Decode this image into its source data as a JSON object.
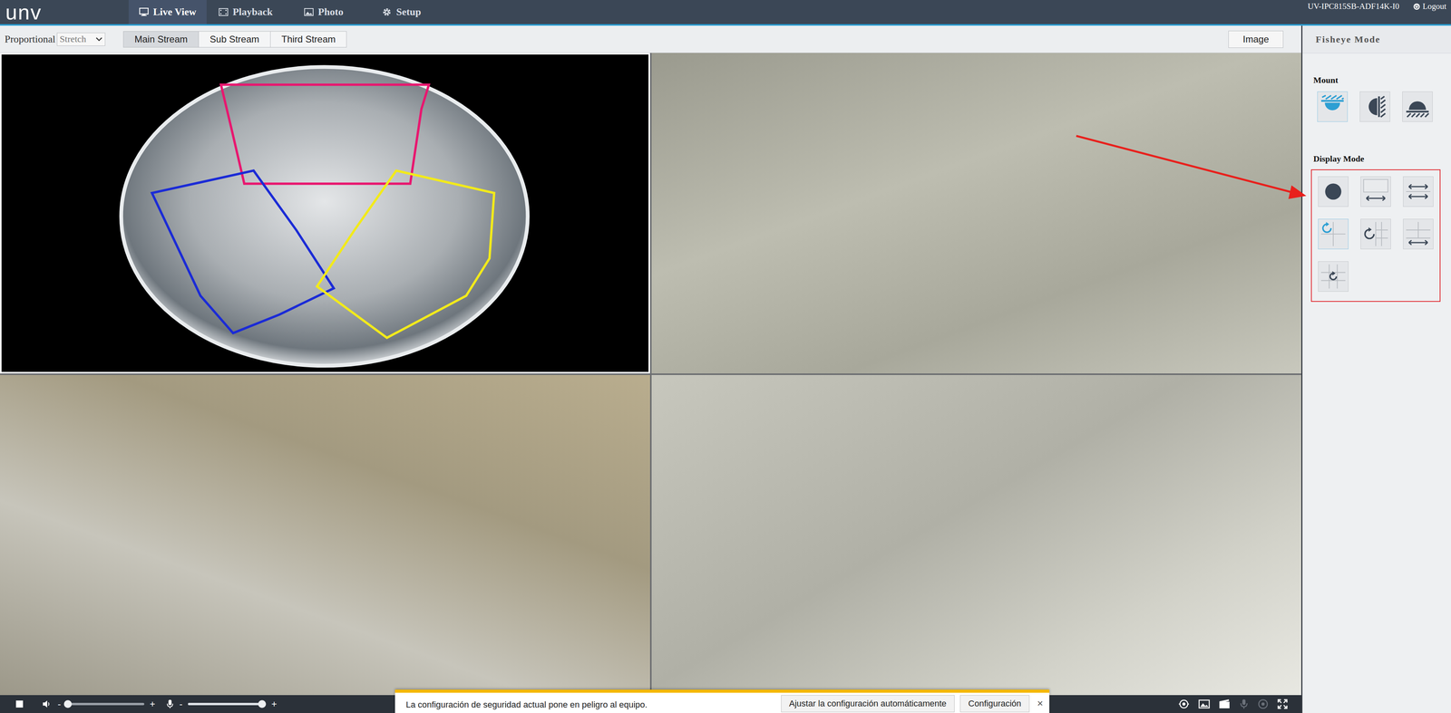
{
  "header": {
    "logo": "unv",
    "tabs": [
      {
        "label": "Live View",
        "selected": true
      },
      {
        "label": "Playback",
        "selected": false
      },
      {
        "label": "Photo",
        "selected": false
      },
      {
        "label": "Setup",
        "selected": false
      }
    ],
    "device": "UV-IPC815SB-ADF14K-I0",
    "logout": "Logout"
  },
  "toolbar": {
    "label": "Proportional",
    "select": "Stretch",
    "streams": [
      {
        "label": "Main Stream",
        "selected": true
      },
      {
        "label": "Sub Stream",
        "selected": false
      },
      {
        "label": "Third Stream",
        "selected": false
      }
    ],
    "image_button": "Image"
  },
  "video": {
    "tiles": [
      {
        "kind": "fisheye",
        "selected": true
      },
      {
        "kind": "view",
        "selected": false
      },
      {
        "kind": "view",
        "selected": false
      },
      {
        "kind": "view",
        "selected": false
      }
    ],
    "regions": [
      {
        "color": "#e8176f"
      },
      {
        "color": "#1b2bd6"
      },
      {
        "color": "#f2ea1b"
      }
    ]
  },
  "controls": {
    "speaker": {
      "minus": "-",
      "plus": "+",
      "level": 0.02
    },
    "mic": {
      "minus": "-",
      "plus": "+",
      "level": 0.95
    },
    "tools": [
      {
        "kind": "fisheye",
        "disabled": false
      },
      {
        "kind": "snapshot",
        "disabled": false
      },
      {
        "kind": "record",
        "disabled": false
      },
      {
        "kind": "talk",
        "disabled": true
      },
      {
        "kind": "ptz",
        "disabled": true
      },
      {
        "kind": "fullscreen",
        "disabled": false
      }
    ]
  },
  "fisheye_panel": {
    "title": "Fisheye Mode",
    "mount_label": "Mount",
    "mounts": [
      {
        "kind": "ceiling",
        "selected": true
      },
      {
        "kind": "wall",
        "selected": false
      },
      {
        "kind": "desktop",
        "selected": false
      }
    ],
    "display_label": "Display Mode",
    "display_modes": [
      {
        "kind": "fisheye",
        "selected": false
      },
      {
        "kind": "panorama",
        "selected": false
      },
      {
        "kind": "double-panorama",
        "selected": false
      },
      {
        "kind": "fisheye-3ptz",
        "selected": true
      },
      {
        "kind": "fisheye-grid",
        "selected": false
      },
      {
        "kind": "panorama-grid",
        "selected": false
      },
      {
        "kind": "fisheye-8ptz",
        "selected": false
      }
    ]
  },
  "notification": {
    "text": "La configuración de seguridad actual pone en peligro al equipo.",
    "buttons": [
      "Ajustar la configuración automáticamente",
      "Configuración"
    ],
    "close": "×"
  }
}
